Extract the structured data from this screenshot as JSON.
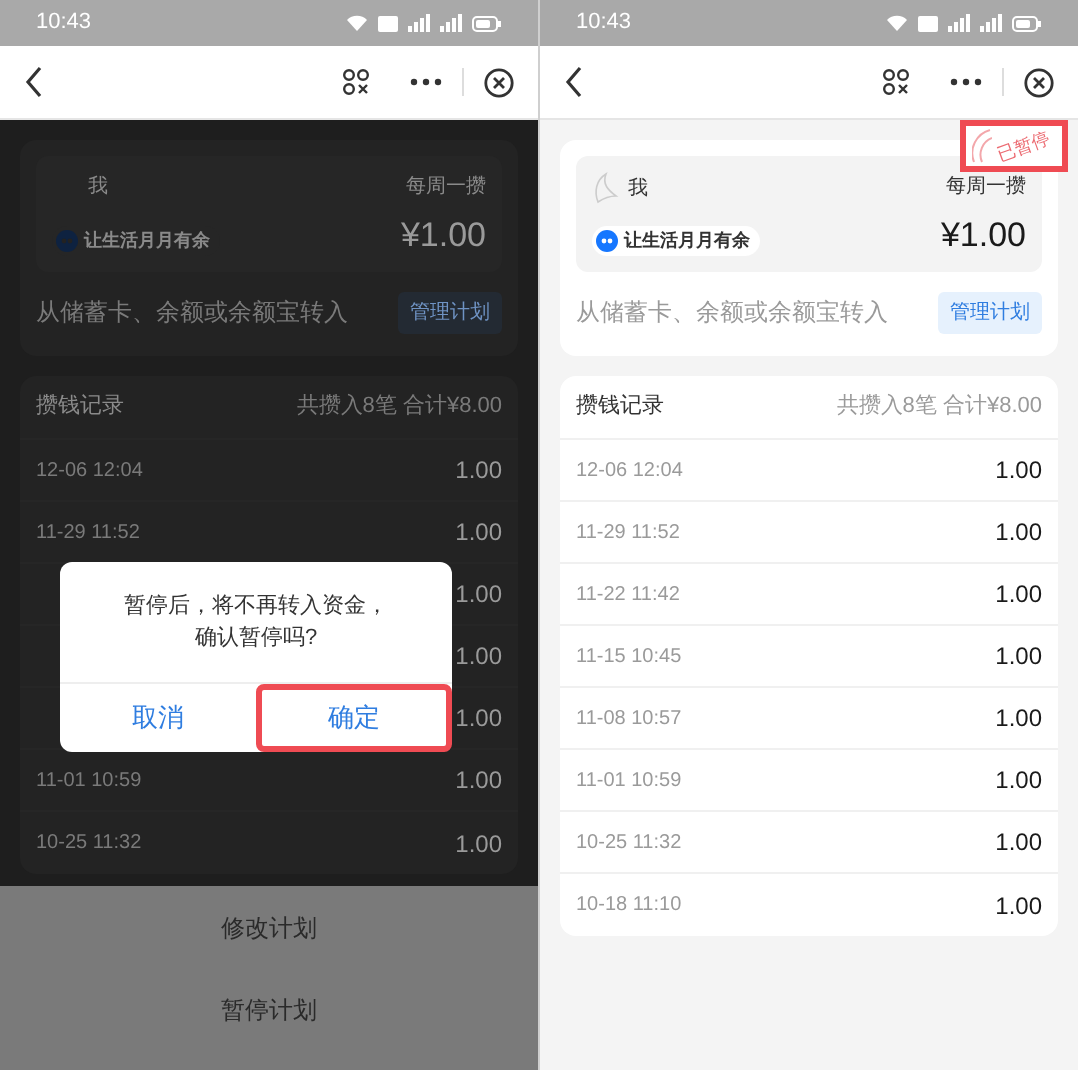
{
  "screens": [
    {
      "dimmed": true,
      "status_time": "10:43",
      "plan": {
        "owner": "我",
        "slogan": "让生活月月有余",
        "frequency": "每周一攒",
        "amount": "¥1.00",
        "source": "从储蓄卡、余额或余额宝转入",
        "manage_button": "管理计划"
      },
      "records": {
        "title": "攒钱记录",
        "summary": "共攒入8笔 合计¥8.00",
        "rows": [
          {
            "date": "12-06 12:04",
            "amount": "1.00"
          },
          {
            "date": "11-29 11:52",
            "amount": "1.00"
          },
          {
            "amount": "1.00"
          },
          {
            "amount": "1.00"
          },
          {
            "amount": "1.00"
          },
          {
            "date": "11-01 10:59",
            "amount": "1.00"
          },
          {
            "date": "10-25 11:32",
            "amount": "1.00"
          }
        ]
      },
      "dialog": {
        "message": "暂停后，将不再转入资金，",
        "message_2": "确认暂停吗?",
        "buttons": [
          {
            "label": "取消",
            "highlighted": false
          },
          {
            "label": "确定",
            "highlighted": true
          }
        ]
      },
      "action_sheet": [
        "修改计划",
        "暂停计划"
      ]
    },
    {
      "dimmed": false,
      "status_time": "10:43",
      "plan": {
        "owner": "我",
        "slogan": "让生活月月有余",
        "frequency": "每周一攒",
        "amount": "¥1.00",
        "source": "从储蓄卡、余额或余额宝转入",
        "manage_button": "管理计划",
        "stamp": {
          "label": "已暂停",
          "highlighted": true
        }
      },
      "records": {
        "title": "攒钱记录",
        "summary": "共攒入8笔 合计¥8.00",
        "rows": [
          {
            "date": "12-06 12:04",
            "amount": "1.00"
          },
          {
            "date": "11-29 11:52",
            "amount": "1.00"
          },
          {
            "date": "11-22 11:42",
            "amount": "1.00"
          },
          {
            "date": "11-15 10:45",
            "amount": "1.00"
          },
          {
            "date": "11-08 10:57",
            "amount": "1.00"
          },
          {
            "date": "11-01 10:59",
            "amount": "1.00"
          },
          {
            "date": "10-25 11:32",
            "amount": "1.00"
          },
          {
            "date": "10-18 11:10",
            "amount": "1.00"
          }
        ]
      }
    }
  ]
}
